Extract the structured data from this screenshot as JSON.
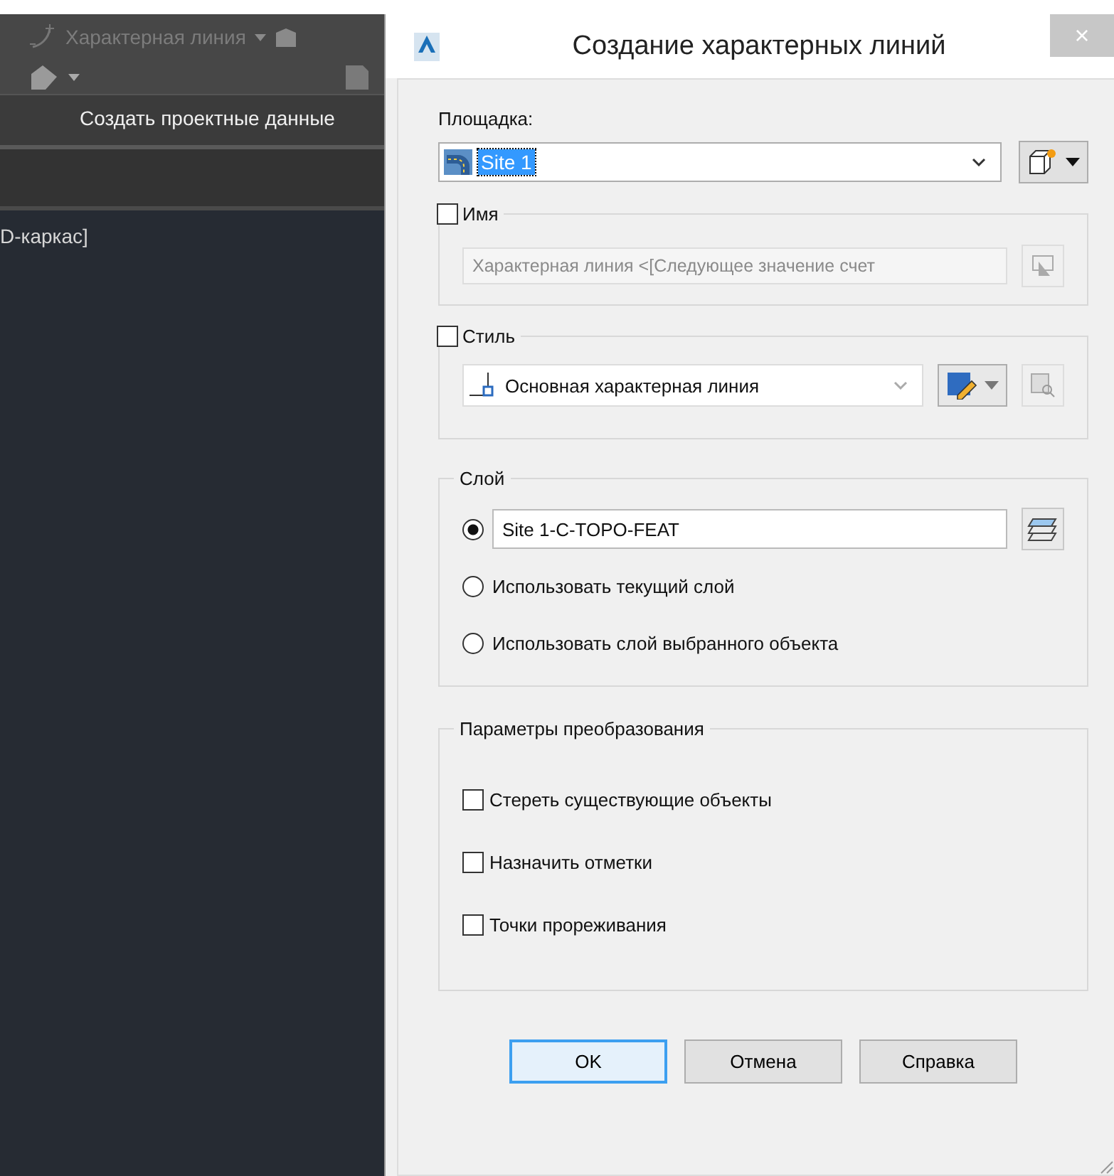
{
  "background_app": {
    "ribbon_tool": "Характерная линия",
    "panel_title": "Создать проектные данные",
    "viewport_label": "D-каркас]"
  },
  "dialog": {
    "title": "Создание характерных линий",
    "close": "×",
    "site": {
      "label": "Площадка:",
      "value": "Site 1"
    },
    "name": {
      "label": "Имя",
      "checked": false,
      "value": "Характерная линия <[Следующее значение счет"
    },
    "style": {
      "label": "Стиль",
      "checked": false,
      "value": "Основная характерная линия"
    },
    "layer": {
      "label": "Слой",
      "options": [
        {
          "kind": "field",
          "value": "Site 1-C-TOPO-FEAT",
          "selected": true
        },
        {
          "kind": "text",
          "label": "Использовать текущий слой",
          "selected": false
        },
        {
          "kind": "text",
          "label": "Использовать слой выбранного объекта",
          "selected": false
        }
      ]
    },
    "conversion": {
      "label": "Параметры преобразования",
      "options": [
        {
          "label": "Стереть существующие объекты",
          "checked": false
        },
        {
          "label": "Назначить отметки",
          "checked": false
        },
        {
          "label": "Точки прореживания",
          "checked": false
        }
      ]
    },
    "buttons": [
      {
        "label": "OK",
        "default": true
      },
      {
        "label": "Отмена",
        "default": false
      },
      {
        "label": "Справка",
        "default": false
      }
    ]
  }
}
